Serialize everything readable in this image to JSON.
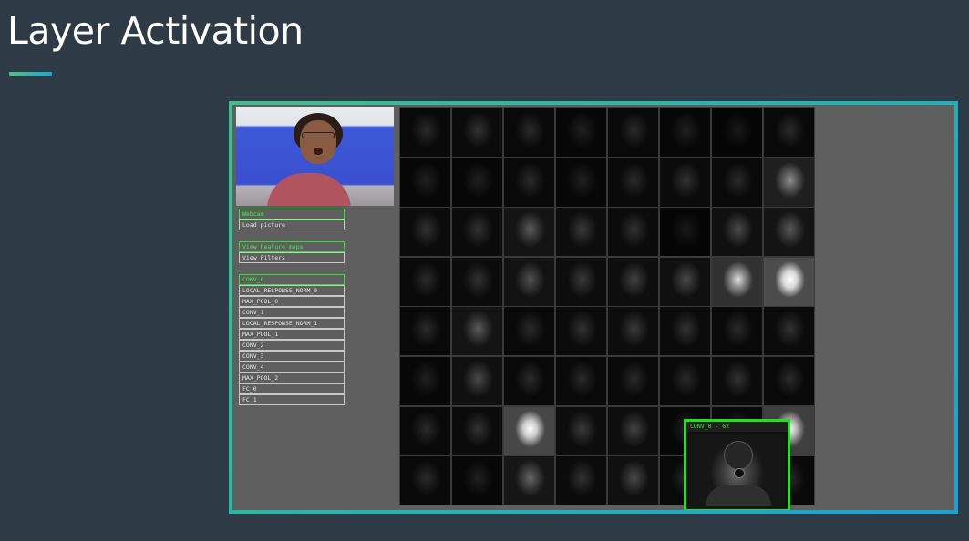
{
  "slide": {
    "title": "Layer Activation"
  },
  "colors": {
    "accent_green": "#27e52a",
    "frame_start": "#3fbf8c",
    "frame_end": "#1aa2d6",
    "background": "#2e3b47"
  },
  "input_controls": [
    {
      "label": "Webcam",
      "active": true
    },
    {
      "label": "Load picture",
      "active": false
    }
  ],
  "view_controls": [
    {
      "label": "View Feature maps",
      "active": true
    },
    {
      "label": "View Filters",
      "active": false
    }
  ],
  "layers": [
    {
      "label": "CONV_0",
      "active": true
    },
    {
      "label": "LOCAL_RESPONSE_NORM_0",
      "active": false
    },
    {
      "label": "MAX_POOL_0",
      "active": false
    },
    {
      "label": "CONV_1",
      "active": false
    },
    {
      "label": "LOCAL_RESPONSE_NORM_1",
      "active": false
    },
    {
      "label": "MAX_POOL_1",
      "active": false
    },
    {
      "label": "CONV_2",
      "active": false
    },
    {
      "label": "CONV_3",
      "active": false
    },
    {
      "label": "CONV_4",
      "active": false
    },
    {
      "label": "MAX_POOL_2",
      "active": false
    },
    {
      "label": "FC_0",
      "active": false
    },
    {
      "label": "FC_1",
      "active": false
    }
  ],
  "feature_map_brightness": [
    [
      0.1,
      0.12,
      0.1,
      0.08,
      0.1,
      0.08,
      0.06,
      0.1
    ],
    [
      0.08,
      0.08,
      0.1,
      0.08,
      0.1,
      0.12,
      0.1,
      0.35
    ],
    [
      0.12,
      0.12,
      0.22,
      0.14,
      0.12,
      0.06,
      0.18,
      0.22
    ],
    [
      0.1,
      0.12,
      0.2,
      0.14,
      0.16,
      0.18,
      0.55,
      0.85
    ],
    [
      0.1,
      0.22,
      0.1,
      0.12,
      0.14,
      0.12,
      0.1,
      0.12
    ],
    [
      0.08,
      0.18,
      0.1,
      0.1,
      0.1,
      0.1,
      0.12,
      0.1
    ],
    [
      0.1,
      0.12,
      0.8,
      0.14,
      0.16,
      0.08,
      0.1,
      0.7
    ],
    [
      0.1,
      0.08,
      0.25,
      0.12,
      0.18,
      0.1,
      0.1,
      0.1
    ]
  ],
  "zoom_panel": {
    "label": "CONV_0 - 62"
  }
}
